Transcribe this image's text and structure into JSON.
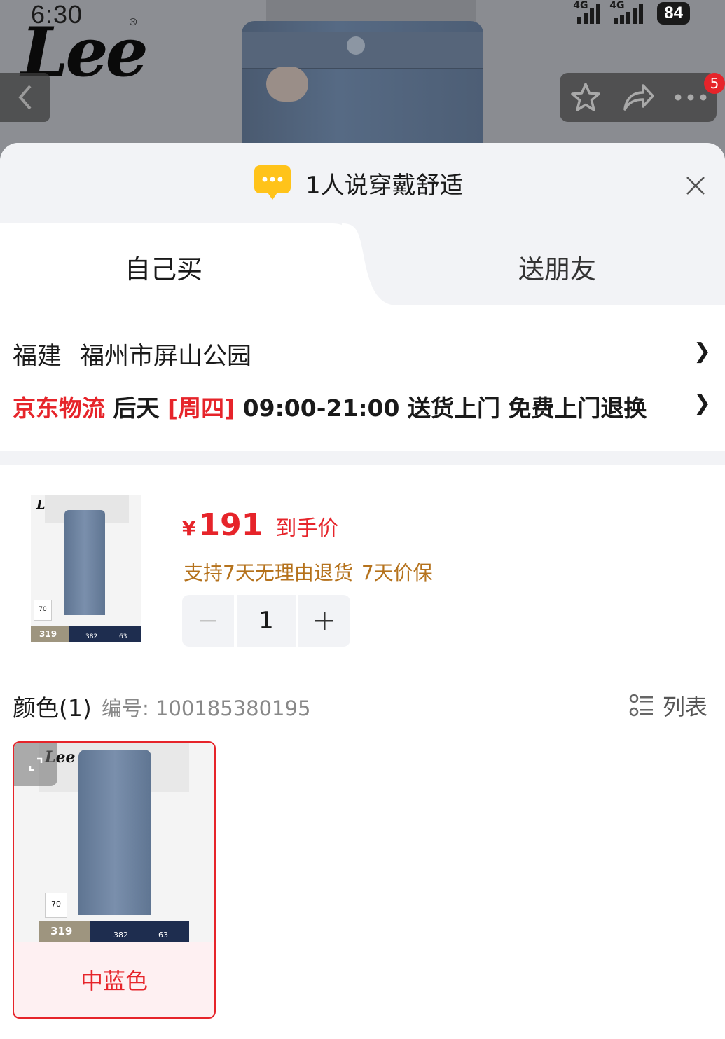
{
  "status_bar": {
    "time": "6:30",
    "signal_1": "4G",
    "signal_2": "4G",
    "battery": "84"
  },
  "banner": {
    "brand": "Lee",
    "brand_mark": "®",
    "more_badge": "5"
  },
  "sheet": {
    "tip_text": "1人说穿戴舒适",
    "tabs": [
      {
        "label": "自己买",
        "active": true
      },
      {
        "label": "送朋友",
        "active": false
      }
    ],
    "address": {
      "province": "福建",
      "detail": "福州市屏山公园"
    },
    "shipping": {
      "carrier": "京东物流",
      "day": "后天",
      "weekday": "[周四]",
      "window": "09:00-21:00 送货上门 免费上门退换"
    }
  },
  "product": {
    "currency": "¥",
    "price": "191",
    "price_label": "到手价",
    "service_1": "支持7天无理由退货",
    "service_2": "7天价保",
    "quantity": "1",
    "thumb_brand": "Lee",
    "thumb_tag_value": "70",
    "thumb_price": "319",
    "thumb_strip_a": "382",
    "thumb_strip_b": "63"
  },
  "color_section": {
    "heading": "颜色(1)",
    "sku_label": "编号: 100185380195",
    "list_label": "列表",
    "options": [
      {
        "label": "中蓝色",
        "selected": true
      }
    ],
    "swatch_brand": "Lee",
    "swatch_tag_value": "70",
    "swatch_price": "319",
    "swatch_strip_a": "382",
    "swatch_strip_b": "63"
  },
  "colors": {
    "accent_red": "#e6242a",
    "service_brown": "#b5721c",
    "panel_gray": "#f2f3f6"
  }
}
